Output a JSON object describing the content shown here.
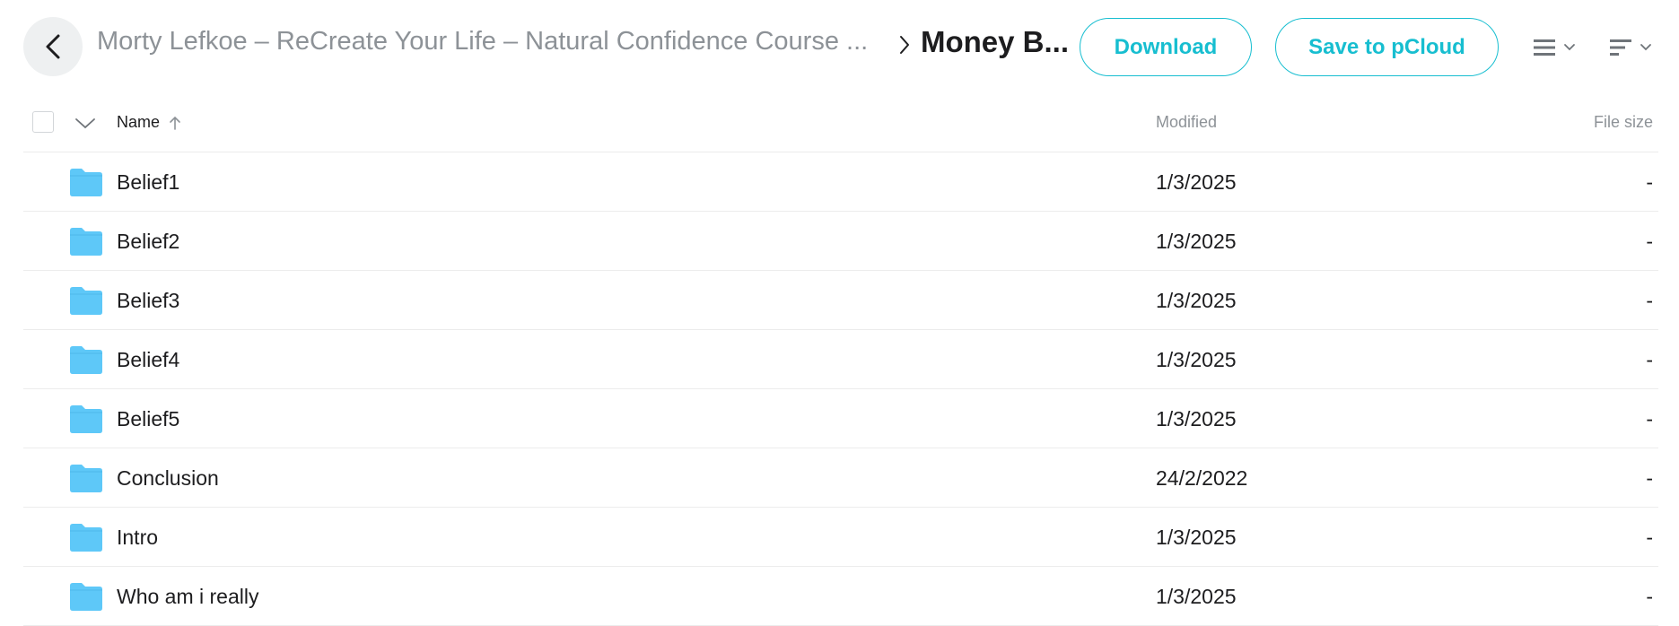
{
  "header": {
    "parent_path": "Morty Lefkoe – ReCreate Your Life – Natural Confidence Course ...",
    "current_folder": "Money B...",
    "download_label": "Download",
    "save_label": "Save to pCloud",
    "icons": {
      "back": "chevron-left-icon",
      "separator": "chevron-right-icon",
      "view": "list-view-icon",
      "sort": "sort-icon",
      "dropdown": "chevron-down-icon"
    }
  },
  "table": {
    "columns": {
      "name": "Name",
      "modified": "Modified",
      "size": "File size"
    },
    "sort_icon": "arrow-up-icon",
    "row_icon": "folder-icon",
    "folder_color": "#5ec8f8",
    "accent_color": "#17bed0",
    "rows": [
      {
        "name": "Belief1",
        "modified": "1/3/2025",
        "size": "-"
      },
      {
        "name": "Belief2",
        "modified": "1/3/2025",
        "size": "-"
      },
      {
        "name": "Belief3",
        "modified": "1/3/2025",
        "size": "-"
      },
      {
        "name": "Belief4",
        "modified": "1/3/2025",
        "size": "-"
      },
      {
        "name": "Belief5",
        "modified": "1/3/2025",
        "size": "-"
      },
      {
        "name": "Conclusion",
        "modified": "24/2/2022",
        "size": "-"
      },
      {
        "name": "Intro",
        "modified": "1/3/2025",
        "size": "-"
      },
      {
        "name": "Who am i really",
        "modified": "1/3/2025",
        "size": "-"
      }
    ]
  }
}
